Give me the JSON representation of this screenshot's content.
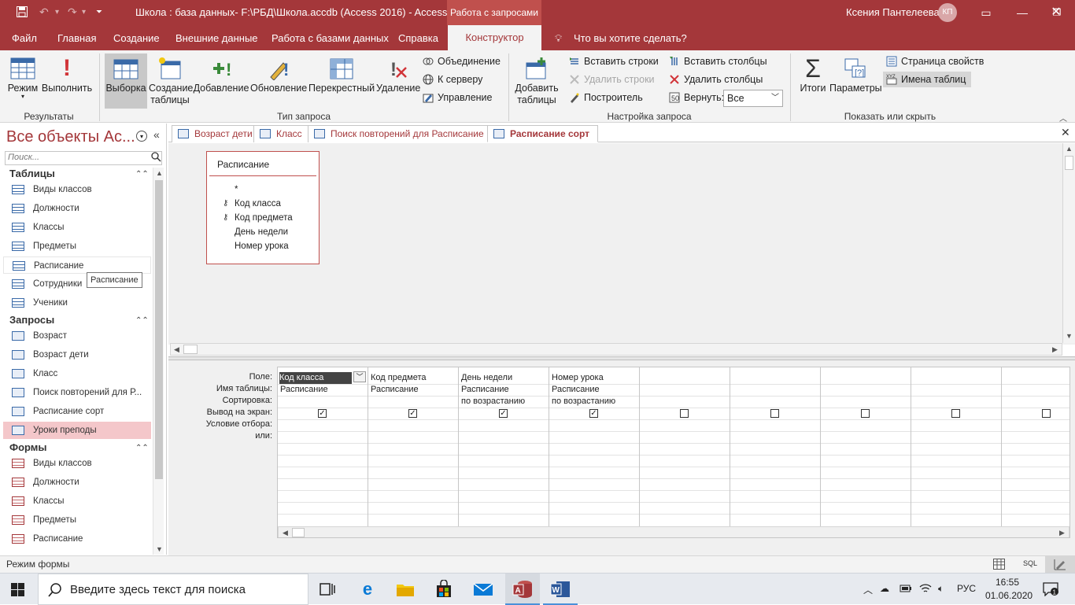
{
  "titlebar": {
    "title": "Школа : база данных- F:\\РБД\\Школа.accdb (Access 2016)  -  Access",
    "context_title": "Работа с запросами",
    "user_name": "Ксения Пантелеева",
    "user_initials": "КП"
  },
  "menu": {
    "tabs": [
      "Файл",
      "Главная",
      "Создание",
      "Внешние данные",
      "Работа с базами данных",
      "Справка"
    ],
    "active_tab": "Конструктор",
    "tell_me": "Что вы хотите сделать?"
  },
  "ribbon": {
    "results": {
      "mode_label": "Режим",
      "run_label": "Выполнить",
      "group_label": "Результаты"
    },
    "query_type": {
      "select_label": "Выборка",
      "make_table_label_1": "Создание",
      "make_table_label_2": "таблицы",
      "append_label": "Добавление",
      "update_label": "Обновление",
      "crosstab_label": "Перекрестный",
      "delete_label": "Удаление",
      "union_label": "Объединение",
      "server_label": "К серверу",
      "manage_label": "Управление",
      "group_label": "Тип запроса"
    },
    "setup": {
      "add_tables_label_1": "Добавить",
      "add_tables_label_2": "таблицы",
      "insert_rows_label": "Вставить строки",
      "delete_rows_label": "Удалить строки",
      "builder_label": "Построитель",
      "insert_cols_label": "Вставить столбцы",
      "delete_cols_label": "Удалить столбцы",
      "return_label": "Вернуть:",
      "return_value": "Все",
      "group_label": "Настройка запроса"
    },
    "show_hide": {
      "totals_label": "Итоги",
      "params_label": "Параметры",
      "property_sheet_label": "Страница свойств",
      "table_names_label": "Имена таблиц",
      "group_label": "Показать или скрыть"
    }
  },
  "nav": {
    "title": "Все объекты Ac...",
    "search_placeholder": "Поиск...",
    "tooltip": "Расписание",
    "groups": [
      {
        "label": "Таблицы",
        "items": [
          "Виды классов",
          "Должности",
          "Классы",
          "Предметы",
          "Расписание",
          "Сотрудники",
          "Ученики"
        ]
      },
      {
        "label": "Запросы",
        "items": [
          "Возраст",
          "Возраст дети",
          "Класс",
          "Поиск повторений для Р...",
          "Расписание сорт",
          "Уроки преподы"
        ]
      },
      {
        "label": "Формы",
        "items": [
          "Виды классов",
          "Должности",
          "Классы",
          "Предметы",
          "Расписание"
        ]
      }
    ]
  },
  "doctabs": [
    "Возраст дети",
    "Класс",
    "Поиск повторений для Расписание",
    "Расписание сорт"
  ],
  "tablebox": {
    "title": "Расписание",
    "fields": [
      "*",
      "Код класса",
      "Код предмета",
      "День недели",
      "Номер урока"
    ]
  },
  "grid": {
    "row_labels": [
      "Поле:",
      "Имя таблицы:",
      "Сортировка:",
      "Вывод на экран:",
      "Условие отбора:",
      "или:"
    ],
    "columns": [
      {
        "field": "Код класса",
        "table": "Расписание",
        "sort": "",
        "show": true
      },
      {
        "field": "Код предмета",
        "table": "Расписание",
        "sort": "",
        "show": true
      },
      {
        "field": "День недели",
        "table": "Расписание",
        "sort": "по возрастанию",
        "show": true
      },
      {
        "field": "Номер урока",
        "table": "Расписание",
        "sort": "по возрастанию",
        "show": true
      },
      {
        "field": "",
        "table": "",
        "sort": "",
        "show": false
      },
      {
        "field": "",
        "table": "",
        "sort": "",
        "show": false
      },
      {
        "field": "",
        "table": "",
        "sort": "",
        "show": false
      },
      {
        "field": "",
        "table": "",
        "sort": "",
        "show": false
      },
      {
        "field": "",
        "table": "",
        "sort": "",
        "show": false
      }
    ]
  },
  "status": {
    "text": "Режим формы",
    "sql_label": "SQL"
  },
  "taskbar": {
    "search_placeholder": "Введите здесь текст для поиска",
    "lang": "РУС",
    "time": "16:55",
    "date": "01.06.2020"
  },
  "colors": {
    "accent": "#a4373a",
    "selected_nav": "#f4c7ca"
  }
}
